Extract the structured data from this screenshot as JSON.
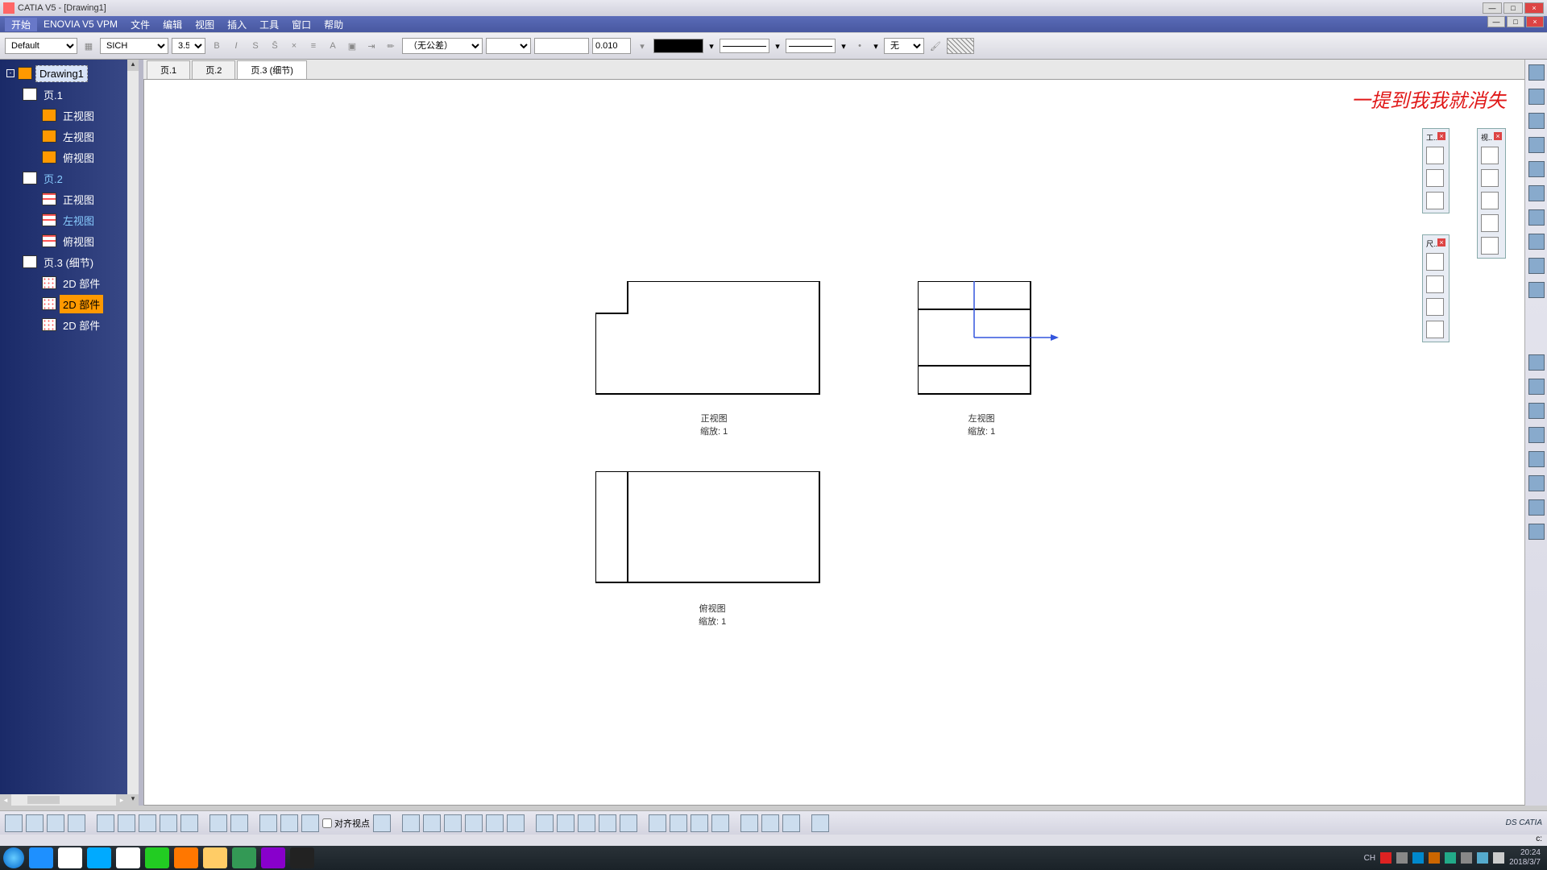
{
  "app": {
    "title": "CATIA V5 - [Drawing1]"
  },
  "menu": {
    "items": [
      "开始",
      "ENOVIA V5 VPM",
      "文件",
      "编辑",
      "视图",
      "插入",
      "工具",
      "窗口",
      "帮助"
    ]
  },
  "toolbar": {
    "style": "Default",
    "font": "SICH",
    "size": "3.5",
    "tolerance": "（无公差）",
    "precision": "0.010",
    "line_none": "无"
  },
  "tabs": {
    "items": [
      "页.1",
      "页.2",
      "页.3 (细节)"
    ],
    "activeIndex": 2
  },
  "tree": {
    "root": "Drawing1",
    "sheets": [
      {
        "name": "页.1",
        "views": [
          "正视图",
          "左视图",
          "俯视图"
        ]
      },
      {
        "name": "页.2",
        "views": [
          "正视图",
          "左视图",
          "俯视图"
        ],
        "highlighted": true,
        "highlightedView": 1
      },
      {
        "name": "页.3 (细节)",
        "items": [
          "2D 部件",
          "2D 部件",
          "2D 部件"
        ],
        "selectedIndex": 1
      }
    ]
  },
  "views": {
    "front": {
      "label": "正视图",
      "scale": "缩放:   1"
    },
    "left": {
      "label": "左视图",
      "scale": "缩放:   1"
    },
    "top": {
      "label": "俯视图",
      "scale": "缩放:   1"
    }
  },
  "watermark": "一提到我我就消失",
  "bottom": {
    "snap_label": "对齐视点"
  },
  "status": {
    "right": "c:"
  },
  "tray": {
    "lang": "CH",
    "time": "20:24",
    "date": "2018/3/7"
  }
}
